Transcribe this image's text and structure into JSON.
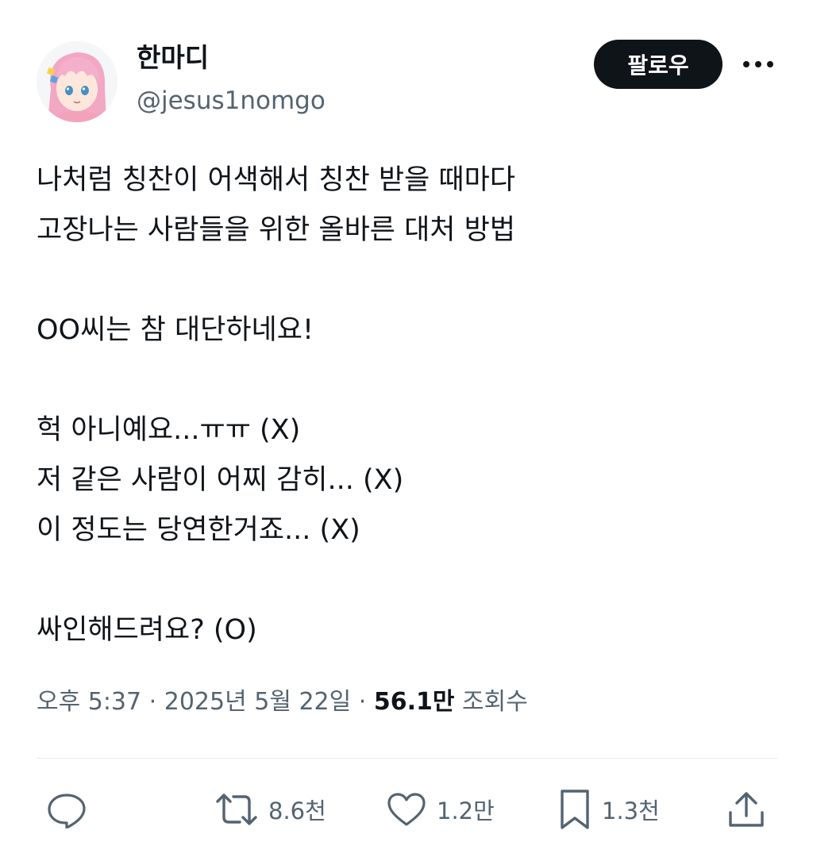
{
  "author": {
    "display_name": "한마디",
    "handle": "@jesus1nomgo"
  },
  "follow_button": {
    "label": "팔로우"
  },
  "more_button": {
    "icon": "more-horizontal-icon"
  },
  "tweet": {
    "lines": [
      "나처럼 칭찬이 어색해서 칭찬 받을 때마다",
      "고장나는 사람들을 위한 올바른 대처 방법",
      "",
      "OO씨는 참 대단하네요!",
      "",
      "헉 아니예요...ㅠㅠ (X)",
      "저 같은 사람이 어찌 감히... (X)",
      "이 정도는 당연한거죠... (X)",
      "",
      "싸인해드려요? (O)"
    ]
  },
  "meta": {
    "time": "오후 5:37",
    "separator": "·",
    "date": "2025년 5월 22일",
    "views_count": "56.1만",
    "views_label": "조회수"
  },
  "actions": {
    "reply": {
      "icon": "reply-icon"
    },
    "retweet": {
      "icon": "retweet-icon",
      "count": "8.6천"
    },
    "like": {
      "icon": "heart-icon",
      "count": "1.2만"
    },
    "bookmark": {
      "icon": "bookmark-icon",
      "count": "1.3천"
    },
    "share": {
      "icon": "share-icon"
    }
  },
  "colors": {
    "text_primary": "#0f1419",
    "text_secondary": "#536471",
    "divider": "#e6ecf0",
    "follow_bg": "#0f1419",
    "avatar_hair": "#f2a7c3"
  }
}
